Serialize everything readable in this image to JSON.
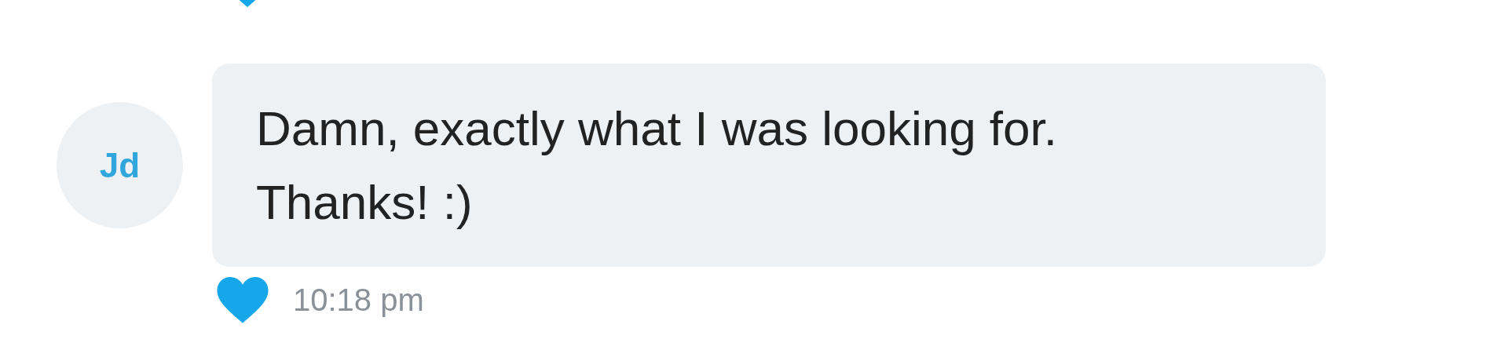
{
  "previous_message": {
    "liked": true
  },
  "message": {
    "avatar_initials": "Jd",
    "text": "Damn, exactly what I was looking for. Thanks! :)",
    "liked": true,
    "time": "10:18 pm"
  }
}
